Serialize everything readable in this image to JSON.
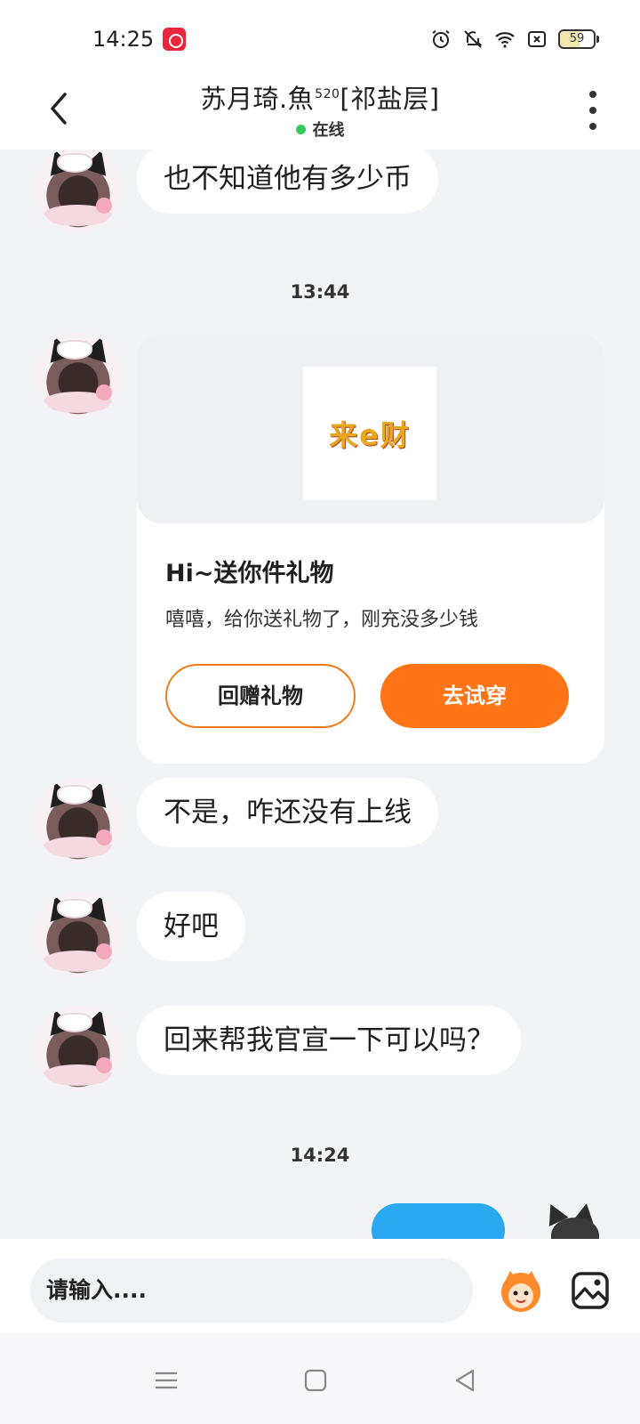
{
  "status_bar": {
    "time": "14:25",
    "battery": "59"
  },
  "header": {
    "title": "苏月琦.魚",
    "title_sup": "520",
    "title_suffix": "[祁盐层]",
    "status": "在线"
  },
  "messages": [
    {
      "text": "也不知道他有多少币"
    },
    {
      "time": "13:44"
    },
    {
      "text": "不是，咋还没有上线"
    },
    {
      "text": "好吧"
    },
    {
      "text": "回来帮我官宣一下可以吗？"
    },
    {
      "time": "14:24"
    }
  ],
  "gift_card": {
    "gift_image_text": "来e财",
    "title": "Hi~送你件礼物",
    "description": "嘻嘻，给你送礼物了，刚充没多少钱",
    "return_label": "回赠礼物",
    "try_label": "去试穿"
  },
  "input": {
    "placeholder": "请输入...."
  },
  "colors": {
    "accent": "#ff7416",
    "online": "#39c85b",
    "outgoing": "#2aa8f0",
    "background": "#f2f3f7"
  },
  "icons": [
    "back-arrow-icon",
    "more-vertical-icon",
    "alarm-icon",
    "mute-icon",
    "wifi-icon",
    "sim-icon",
    "battery-icon",
    "emoji-icon",
    "image-icon",
    "menu-icon",
    "home-icon",
    "back-triangle-icon"
  ]
}
